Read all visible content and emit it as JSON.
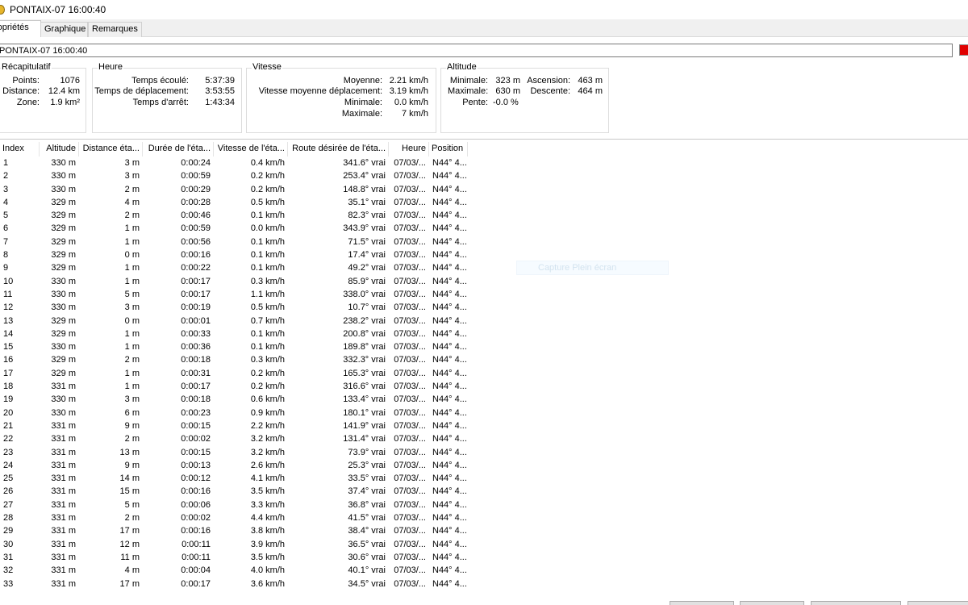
{
  "window": {
    "title": "PONTAIX-07 16:00:40"
  },
  "tabs": [
    "ropriétés",
    "Graphique",
    "Remarques"
  ],
  "name_field": {
    "value": "PONTAIX-07 16:00:40"
  },
  "colors": {
    "track_color": "#e00000"
  },
  "summary": {
    "legend": "Récapitulatif",
    "points_label": "Points:",
    "points_value": "1076",
    "distance_label": "Distance:",
    "distance_value": "12.4 km",
    "zone_label": "Zone:",
    "zone_value": "1.9 km²"
  },
  "time": {
    "legend": "Heure",
    "elapsed_label": "Temps écoulé:",
    "elapsed_value": "5:37:39",
    "moving_label": "Temps de déplacement:",
    "moving_value": "3:53:55",
    "stopped_label": "Temps d'arrêt:",
    "stopped_value": "1:43:34"
  },
  "speed": {
    "legend": "Vitesse",
    "avg_label": "Moyenne:",
    "avg_value": "2.21 km/h",
    "avg_moving_label": "Vitesse moyenne déplacement:",
    "avg_moving_value": "3.19 km/h",
    "min_label": "Minimale:",
    "min_value": "0.0 km/h",
    "max_label": "Maximale:",
    "max_value": "7 km/h"
  },
  "altitude": {
    "legend": "Altitude",
    "min_label": "Minimale:",
    "min_value": "323 m",
    "max_label": "Maximale:",
    "max_value": "630 m",
    "slope_label": "Pente:",
    "slope_value": "-0.0 %",
    "ascent_label": "Ascension:",
    "ascent_value": "463 m",
    "descent_label": "Descente:",
    "descent_value": "464 m"
  },
  "table": {
    "headers": [
      "Index",
      "Altitude",
      "Distance éta...",
      "Durée de l'éta...",
      "Vitesse de l'éta...",
      "Route désirée de l'éta...",
      "Heure",
      "Position"
    ],
    "rows": [
      [
        "1",
        "330 m",
        "3 m",
        "0:00:24",
        "0.4 km/h",
        "341.6° vrai",
        "07/03/...",
        "N44° 4..."
      ],
      [
        "2",
        "330 m",
        "3 m",
        "0:00:59",
        "0.2 km/h",
        "253.4° vrai",
        "07/03/...",
        "N44° 4..."
      ],
      [
        "3",
        "330 m",
        "2 m",
        "0:00:29",
        "0.2 km/h",
        "148.8° vrai",
        "07/03/...",
        "N44° 4..."
      ],
      [
        "4",
        "329 m",
        "4 m",
        "0:00:28",
        "0.5 km/h",
        "35.1° vrai",
        "07/03/...",
        "N44° 4..."
      ],
      [
        "5",
        "329 m",
        "2 m",
        "0:00:46",
        "0.1 km/h",
        "82.3° vrai",
        "07/03/...",
        "N44° 4..."
      ],
      [
        "6",
        "329 m",
        "1 m",
        "0:00:59",
        "0.0 km/h",
        "343.9° vrai",
        "07/03/...",
        "N44° 4..."
      ],
      [
        "7",
        "329 m",
        "1 m",
        "0:00:56",
        "0.1 km/h",
        "71.5° vrai",
        "07/03/...",
        "N44° 4..."
      ],
      [
        "8",
        "329 m",
        "0 m",
        "0:00:16",
        "0.1 km/h",
        "17.4° vrai",
        "07/03/...",
        "N44° 4..."
      ],
      [
        "9",
        "329 m",
        "1 m",
        "0:00:22",
        "0.1 km/h",
        "49.2° vrai",
        "07/03/...",
        "N44° 4..."
      ],
      [
        "10",
        "330 m",
        "1 m",
        "0:00:17",
        "0.3 km/h",
        "85.9° vrai",
        "07/03/...",
        "N44° 4..."
      ],
      [
        "11",
        "330 m",
        "5 m",
        "0:00:17",
        "1.1 km/h",
        "338.0° vrai",
        "07/03/...",
        "N44° 4..."
      ],
      [
        "12",
        "330 m",
        "3 m",
        "0:00:19",
        "0.5 km/h",
        "10.7° vrai",
        "07/03/...",
        "N44° 4..."
      ],
      [
        "13",
        "329 m",
        "0 m",
        "0:00:01",
        "0.7 km/h",
        "238.2° vrai",
        "07/03/...",
        "N44° 4..."
      ],
      [
        "14",
        "329 m",
        "1 m",
        "0:00:33",
        "0.1 km/h",
        "200.8° vrai",
        "07/03/...",
        "N44° 4..."
      ],
      [
        "15",
        "330 m",
        "1 m",
        "0:00:36",
        "0.1 km/h",
        "189.8° vrai",
        "07/03/...",
        "N44° 4..."
      ],
      [
        "16",
        "329 m",
        "2 m",
        "0:00:18",
        "0.3 km/h",
        "332.3° vrai",
        "07/03/...",
        "N44° 4..."
      ],
      [
        "17",
        "329 m",
        "1 m",
        "0:00:31",
        "0.2 km/h",
        "165.3° vrai",
        "07/03/...",
        "N44° 4..."
      ],
      [
        "18",
        "331 m",
        "1 m",
        "0:00:17",
        "0.2 km/h",
        "316.6° vrai",
        "07/03/...",
        "N44° 4..."
      ],
      [
        "19",
        "330 m",
        "3 m",
        "0:00:18",
        "0.6 km/h",
        "133.4° vrai",
        "07/03/...",
        "N44° 4..."
      ],
      [
        "20",
        "330 m",
        "6 m",
        "0:00:23",
        "0.9 km/h",
        "180.1° vrai",
        "07/03/...",
        "N44° 4..."
      ],
      [
        "21",
        "331 m",
        "9 m",
        "0:00:15",
        "2.2 km/h",
        "141.9° vrai",
        "07/03/...",
        "N44° 4..."
      ],
      [
        "22",
        "331 m",
        "2 m",
        "0:00:02",
        "3.2 km/h",
        "131.4° vrai",
        "07/03/...",
        "N44° 4..."
      ],
      [
        "23",
        "331 m",
        "13 m",
        "0:00:15",
        "3.2 km/h",
        "73.9° vrai",
        "07/03/...",
        "N44° 4..."
      ],
      [
        "24",
        "331 m",
        "9 m",
        "0:00:13",
        "2.6 km/h",
        "25.3° vrai",
        "07/03/...",
        "N44° 4..."
      ],
      [
        "25",
        "331 m",
        "14 m",
        "0:00:12",
        "4.1 km/h",
        "33.5° vrai",
        "07/03/...",
        "N44° 4..."
      ],
      [
        "26",
        "331 m",
        "15 m",
        "0:00:16",
        "3.5 km/h",
        "37.4° vrai",
        "07/03/...",
        "N44° 4..."
      ],
      [
        "27",
        "331 m",
        "5 m",
        "0:00:06",
        "3.3 km/h",
        "36.8° vrai",
        "07/03/...",
        "N44° 4..."
      ],
      [
        "28",
        "331 m",
        "2 m",
        "0:00:02",
        "4.4 km/h",
        "41.5° vrai",
        "07/03/...",
        "N44° 4..."
      ],
      [
        "29",
        "331 m",
        "17 m",
        "0:00:16",
        "3.8 km/h",
        "38.4° vrai",
        "07/03/...",
        "N44° 4..."
      ],
      [
        "30",
        "331 m",
        "12 m",
        "0:00:11",
        "3.9 km/h",
        "36.5° vrai",
        "07/03/...",
        "N44° 4..."
      ],
      [
        "31",
        "331 m",
        "11 m",
        "0:00:11",
        "3.5 km/h",
        "30.6° vrai",
        "07/03/...",
        "N44° 4..."
      ],
      [
        "32",
        "331 m",
        "4 m",
        "0:00:04",
        "4.0 km/h",
        "40.1° vrai",
        "07/03/...",
        "N44° 4..."
      ],
      [
        "33",
        "331 m",
        "17 m",
        "0:00:17",
        "3.6 km/h",
        "34.5° vrai",
        "07/03/...",
        "N44° 4..."
      ]
    ]
  },
  "overlay": {
    "label": "Capture Plein écran"
  }
}
